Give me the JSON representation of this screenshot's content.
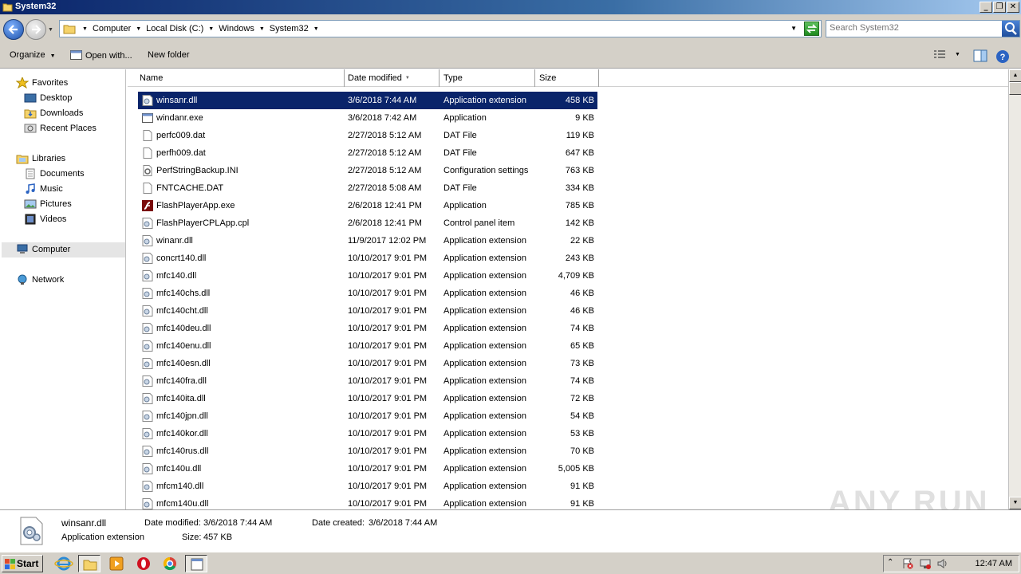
{
  "window": {
    "title": "System32"
  },
  "address": {
    "breadcrumbs": [
      "Computer",
      "Local Disk (C:)",
      "Windows",
      "System32"
    ],
    "search_placeholder": "Search System32"
  },
  "toolbar": {
    "organize": "Organize",
    "open_with": "Open with...",
    "new_folder": "New folder"
  },
  "nav": {
    "favorites": "Favorites",
    "desktop": "Desktop",
    "downloads": "Downloads",
    "recent_places": "Recent Places",
    "libraries": "Libraries",
    "documents": "Documents",
    "music": "Music",
    "pictures": "Pictures",
    "videos": "Videos",
    "computer": "Computer",
    "network": "Network"
  },
  "columns": {
    "name": "Name",
    "date": "Date modified",
    "type": "Type",
    "size": "Size"
  },
  "files": [
    {
      "name": "winsanr.dll",
      "date": "3/6/2018 7:44 AM",
      "type": "Application extension",
      "size": "458 KB",
      "icon": "dll-icon",
      "selected": true
    },
    {
      "name": "windanr.exe",
      "date": "3/6/2018 7:42 AM",
      "type": "Application",
      "size": "9 KB",
      "icon": "exe-icon"
    },
    {
      "name": "perfc009.dat",
      "date": "2/27/2018 5:12 AM",
      "type": "DAT File",
      "size": "119 KB",
      "icon": "file-icon"
    },
    {
      "name": "perfh009.dat",
      "date": "2/27/2018 5:12 AM",
      "type": "DAT File",
      "size": "647 KB",
      "icon": "file-icon"
    },
    {
      "name": "PerfStringBackup.INI",
      "date": "2/27/2018 5:12 AM",
      "type": "Configuration settings",
      "size": "763 KB",
      "icon": "ini-icon"
    },
    {
      "name": "FNTCACHE.DAT",
      "date": "2/27/2018 5:08 AM",
      "type": "DAT File",
      "size": "334 KB",
      "icon": "file-icon"
    },
    {
      "name": "FlashPlayerApp.exe",
      "date": "2/6/2018 12:41 PM",
      "type": "Application",
      "size": "785 KB",
      "icon": "flash-icon"
    },
    {
      "name": "FlashPlayerCPLApp.cpl",
      "date": "2/6/2018 12:41 PM",
      "type": "Control panel item",
      "size": "142 KB",
      "icon": "dll-icon"
    },
    {
      "name": "winanr.dll",
      "date": "11/9/2017 12:02 PM",
      "type": "Application extension",
      "size": "22 KB",
      "icon": "dll-icon"
    },
    {
      "name": "concrt140.dll",
      "date": "10/10/2017 9:01 PM",
      "type": "Application extension",
      "size": "243 KB",
      "icon": "dll-icon"
    },
    {
      "name": "mfc140.dll",
      "date": "10/10/2017 9:01 PM",
      "type": "Application extension",
      "size": "4,709 KB",
      "icon": "dll-icon"
    },
    {
      "name": "mfc140chs.dll",
      "date": "10/10/2017 9:01 PM",
      "type": "Application extension",
      "size": "46 KB",
      "icon": "dll-icon"
    },
    {
      "name": "mfc140cht.dll",
      "date": "10/10/2017 9:01 PM",
      "type": "Application extension",
      "size": "46 KB",
      "icon": "dll-icon"
    },
    {
      "name": "mfc140deu.dll",
      "date": "10/10/2017 9:01 PM",
      "type": "Application extension",
      "size": "74 KB",
      "icon": "dll-icon"
    },
    {
      "name": "mfc140enu.dll",
      "date": "10/10/2017 9:01 PM",
      "type": "Application extension",
      "size": "65 KB",
      "icon": "dll-icon"
    },
    {
      "name": "mfc140esn.dll",
      "date": "10/10/2017 9:01 PM",
      "type": "Application extension",
      "size": "73 KB",
      "icon": "dll-icon"
    },
    {
      "name": "mfc140fra.dll",
      "date": "10/10/2017 9:01 PM",
      "type": "Application extension",
      "size": "74 KB",
      "icon": "dll-icon"
    },
    {
      "name": "mfc140ita.dll",
      "date": "10/10/2017 9:01 PM",
      "type": "Application extension",
      "size": "72 KB",
      "icon": "dll-icon"
    },
    {
      "name": "mfc140jpn.dll",
      "date": "10/10/2017 9:01 PM",
      "type": "Application extension",
      "size": "54 KB",
      "icon": "dll-icon"
    },
    {
      "name": "mfc140kor.dll",
      "date": "10/10/2017 9:01 PM",
      "type": "Application extension",
      "size": "53 KB",
      "icon": "dll-icon"
    },
    {
      "name": "mfc140rus.dll",
      "date": "10/10/2017 9:01 PM",
      "type": "Application extension",
      "size": "70 KB",
      "icon": "dll-icon"
    },
    {
      "name": "mfc140u.dll",
      "date": "10/10/2017 9:01 PM",
      "type": "Application extension",
      "size": "5,005 KB",
      "icon": "dll-icon"
    },
    {
      "name": "mfcm140.dll",
      "date": "10/10/2017 9:01 PM",
      "type": "Application extension",
      "size": "91 KB",
      "icon": "dll-icon"
    },
    {
      "name": "mfcm140u.dll",
      "date": "10/10/2017 9:01 PM",
      "type": "Application extension",
      "size": "91 KB",
      "icon": "dll-icon"
    }
  ],
  "details": {
    "filename": "winsanr.dll",
    "type": "Application extension",
    "modified_label": "Date modified:",
    "modified": "3/6/2018 7:44 AM",
    "created_label": "Date created:",
    "created": "3/6/2018 7:44 AM",
    "size_label": "Size:",
    "size": "457 KB"
  },
  "watermark": "ANY RUN",
  "taskbar": {
    "start": "Start",
    "clock": "12:47 AM"
  },
  "colors": {
    "selection": "#0a246a",
    "titlebar": "#0a246a",
    "chrome": "#d4d0c8"
  }
}
